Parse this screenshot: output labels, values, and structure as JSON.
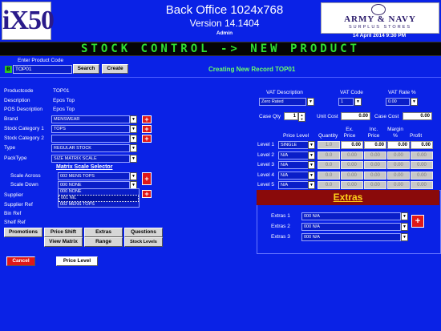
{
  "header": {
    "logo": "iX50",
    "title": "Back Office 1024x768",
    "version": "Version 14.1404",
    "user": "Admin",
    "brand_line1": "ARMY & NAVY",
    "brand_line2": "SURPLUS STORES",
    "datetime": "14 April 2014 9:30 PM"
  },
  "marquee": "STOCK CONTROL -> NEW PRODUCT",
  "product_code": {
    "label": "Enter Product Code",
    "value": "TOP01",
    "badge": "B",
    "search": "Search",
    "create": "Create"
  },
  "status": "Creating New Record TOP01",
  "fields": {
    "productcode_label": "Productcode",
    "productcode_value": "TOP01",
    "description_label": "Description",
    "description_value": "Epos Top",
    "pos_label": "POS Description",
    "pos_value": "Epos Top",
    "brand_label": "Brand",
    "brand_value": "MENSWEAR",
    "cat1_label": "Stock Category 1",
    "cat1_value": "TOPS",
    "cat2_label": "Stock Category 2",
    "cat2_value": "",
    "type_label": "Type",
    "type_value": "REGULAR STOCK",
    "packtype_label": "PackType",
    "packtype_value": "SIZE MATRIX SCALE",
    "matrix_heading": "Matrix Scale Selector",
    "scale_across_label": "Scale Across",
    "scale_across_value": "002 MENS TOPS",
    "scale_down_label": "Scale Down",
    "scale_down_value": "000 NONE",
    "scale_down_options": [
      "000 NONE",
      "001 NIL",
      "002 MENS TOPS"
    ],
    "supplier_label": "Supplier",
    "supplier_ref_label": "Supplier Ref",
    "bin_ref_label": "Bin Ref",
    "shelf_ref_label": "Shelf Ref"
  },
  "buttons_row1": [
    "Promotions",
    "Price Shift",
    "Extras",
    "Questions"
  ],
  "buttons_row2": [
    "View Matrix",
    "Range",
    "Stock Levels"
  ],
  "cancel": "Cancel",
  "price_level_btn": "Price Level",
  "vat": {
    "desc_label": "VAT Description",
    "desc_value": "Zero Rated",
    "code_label": "VAT Code",
    "code_value": "1",
    "rate_label": "VAT Rate %",
    "rate_value": "0.00"
  },
  "costs": {
    "case_qty_label": "Case Qty",
    "case_qty_value": "1",
    "unit_cost_label": "Unit Cost",
    "unit_cost_value": "0.00",
    "case_cost_label": "Case Cost",
    "case_cost_value": "0.00"
  },
  "levels": {
    "headers": {
      "price_level": "Price Level",
      "quantity": "Quantity",
      "ex_price": "Ex. Price",
      "inc_price": "Inc. Price",
      "margin": "Margin %",
      "profit": "Profit"
    },
    "rows": [
      {
        "label": "Level 1",
        "pl": "SINGLE",
        "qty": "1.0",
        "ex": "0.00",
        "inc": "0.00",
        "margin": "0.00",
        "profit": "0.00"
      },
      {
        "label": "Level 2",
        "pl": "N/A",
        "qty": "0.0",
        "ex": "0.00",
        "inc": "0.00",
        "margin": "0.00",
        "profit": "0.00"
      },
      {
        "label": "Level 3",
        "pl": "N/A",
        "qty": "0.0",
        "ex": "0.00",
        "inc": "0.00",
        "margin": "0.00",
        "profit": "0.00"
      },
      {
        "label": "Level 4",
        "pl": "N/A",
        "qty": "0.0",
        "ex": "0.00",
        "inc": "0.00",
        "margin": "0.00",
        "profit": "0.00"
      },
      {
        "label": "Level 5",
        "pl": "N/A",
        "qty": "0.0",
        "ex": "0.00",
        "inc": "0.00",
        "margin": "0.00",
        "profit": "0.00"
      }
    ]
  },
  "extras": {
    "title": "Extras",
    "rows": [
      {
        "label": "Extras 1",
        "value": "000 N/A"
      },
      {
        "label": "Extras 2",
        "value": "000 N/A"
      },
      {
        "label": "Extras 3",
        "value": "000 N/A"
      }
    ]
  }
}
